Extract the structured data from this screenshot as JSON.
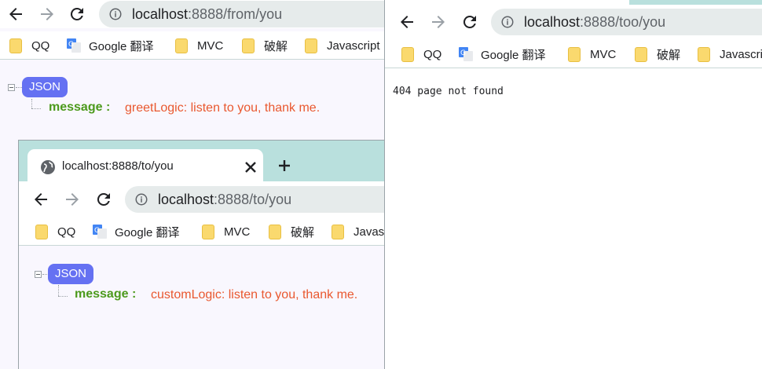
{
  "windows": [
    {
      "id": "from",
      "url_host": "localhost",
      "url_path": ":8888/from/you",
      "bookmarks": [
        "QQ",
        "Google 翻译",
        "MVC",
        "破解",
        "Javascript"
      ],
      "json_badge": "JSON",
      "json_key": "message :",
      "json_value": "greetLogic: listen to you, thank me."
    },
    {
      "id": "to",
      "tab_title": "localhost:8888/to/you",
      "url_host": "localhost",
      "url_path": ":8888/to/you",
      "bookmarks": [
        "QQ",
        "Google 翻译",
        "MVC",
        "破解",
        "Javasc"
      ],
      "json_badge": "JSON",
      "json_key": "message :",
      "json_value": "customLogic: listen to you, thank me."
    },
    {
      "id": "too",
      "url_host": "localhost",
      "url_path": ":8888/too/you",
      "bookmarks": [
        "QQ",
        "Google 翻译",
        "MVC",
        "破解",
        "Javascri"
      ],
      "body_text": "404 page not found"
    }
  ],
  "colors": {
    "tabstrip": "#b9e0dd",
    "json_badge": "#6571f2",
    "json_key": "#4c9a1c",
    "json_value": "#e9582f"
  },
  "icons": [
    "back-arrow-icon",
    "forward-arrow-icon",
    "reload-icon",
    "info-icon",
    "globe-icon",
    "close-icon",
    "new-tab-icon",
    "folder-icon",
    "google-translate-icon"
  ]
}
